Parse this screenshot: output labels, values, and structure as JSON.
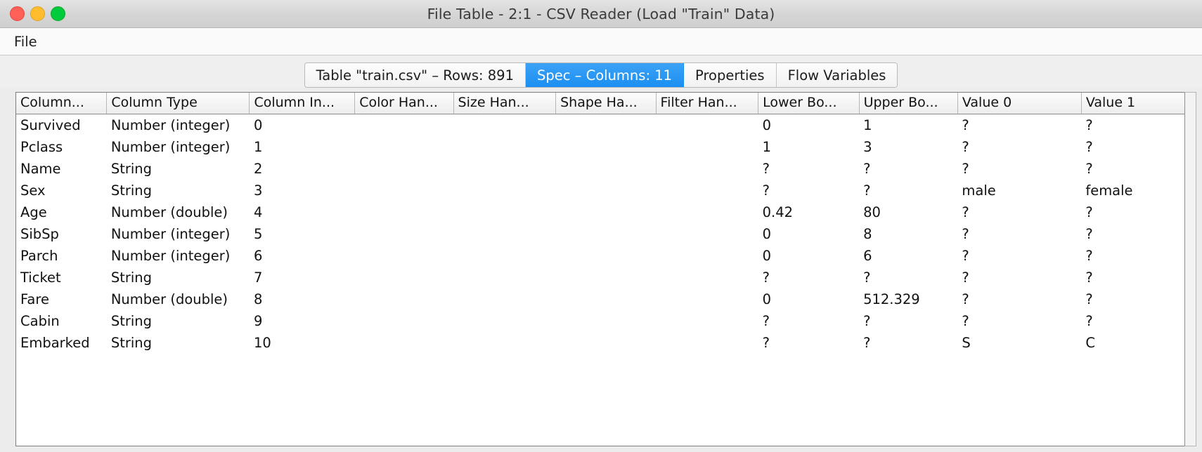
{
  "window": {
    "title": "File Table - 2:1 - CSV Reader (Load \"Train\" Data)",
    "traffic_lights": {
      "close": "close-button",
      "minimize": "minimize-button",
      "maximize": "maximize-button"
    },
    "colors": {
      "close": "#ff6057",
      "minimize": "#ffbd2e",
      "maximize": "#00cb3d",
      "tab_selected": "#1a8ff2",
      "missing_value": "#e00000"
    }
  },
  "menubar": {
    "items": [
      {
        "label": "File"
      }
    ]
  },
  "tabs": [
    {
      "label": "Table \"train.csv\" – Rows: 891",
      "selected": false
    },
    {
      "label": "Spec – Columns: 11",
      "selected": true
    },
    {
      "label": "Properties",
      "selected": false
    },
    {
      "label": "Flow Variables",
      "selected": false
    }
  ],
  "table": {
    "headers": [
      "Column...",
      "Column Type",
      "Column In...",
      "Color Han...",
      "Size Han...",
      "Shape Ha...",
      "Filter Han...",
      "Lower Bo...",
      "Upper Bo...",
      "Value 0",
      "Value 1"
    ],
    "missing_symbol": "?",
    "rows": [
      {
        "name": "Survived",
        "type": "Number (integer)",
        "index": "0",
        "color": "",
        "size": "",
        "shape": "",
        "filter": "",
        "lower": "0",
        "upper": "1",
        "value0": "?",
        "value1": "?"
      },
      {
        "name": "Pclass",
        "type": "Number (integer)",
        "index": "1",
        "color": "",
        "size": "",
        "shape": "",
        "filter": "",
        "lower": "1",
        "upper": "3",
        "value0": "?",
        "value1": "?"
      },
      {
        "name": "Name",
        "type": "String",
        "index": "2",
        "color": "",
        "size": "",
        "shape": "",
        "filter": "",
        "lower": "?",
        "upper": "?",
        "value0": "?",
        "value1": "?"
      },
      {
        "name": "Sex",
        "type": "String",
        "index": "3",
        "color": "",
        "size": "",
        "shape": "",
        "filter": "",
        "lower": "?",
        "upper": "?",
        "value0": "male",
        "value1": "female"
      },
      {
        "name": "Age",
        "type": "Number (double)",
        "index": "4",
        "color": "",
        "size": "",
        "shape": "",
        "filter": "",
        "lower": "0.42",
        "upper": "80",
        "value0": "?",
        "value1": "?"
      },
      {
        "name": "SibSp",
        "type": "Number (integer)",
        "index": "5",
        "color": "",
        "size": "",
        "shape": "",
        "filter": "",
        "lower": "0",
        "upper": "8",
        "value0": "?",
        "value1": "?"
      },
      {
        "name": "Parch",
        "type": "Number (integer)",
        "index": "6",
        "color": "",
        "size": "",
        "shape": "",
        "filter": "",
        "lower": "0",
        "upper": "6",
        "value0": "?",
        "value1": "?"
      },
      {
        "name": "Ticket",
        "type": "String",
        "index": "7",
        "color": "",
        "size": "",
        "shape": "",
        "filter": "",
        "lower": "?",
        "upper": "?",
        "value0": "?",
        "value1": "?"
      },
      {
        "name": "Fare",
        "type": "Number (double)",
        "index": "8",
        "color": "",
        "size": "",
        "shape": "",
        "filter": "",
        "lower": "0",
        "upper": "512.329",
        "value0": "?",
        "value1": "?"
      },
      {
        "name": "Cabin",
        "type": "String",
        "index": "9",
        "color": "",
        "size": "",
        "shape": "",
        "filter": "",
        "lower": "?",
        "upper": "?",
        "value0": "?",
        "value1": "?"
      },
      {
        "name": "Embarked",
        "type": "String",
        "index": "10",
        "color": "",
        "size": "",
        "shape": "",
        "filter": "",
        "lower": "?",
        "upper": "?",
        "value0": "S",
        "value1": "C"
      }
    ]
  }
}
